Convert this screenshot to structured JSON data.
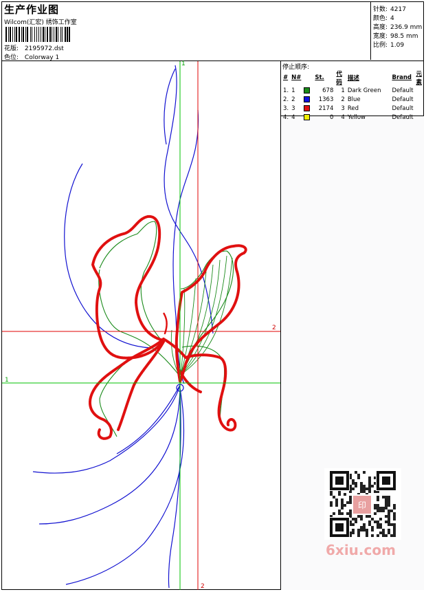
{
  "header": {
    "title": "生产作业图",
    "subtitle": "Wilcom(汇宏) 绣饰工作室",
    "design_label": "花版:",
    "design_value": "2195972.dst",
    "color_label": "色位:",
    "color_value": "Colorway 1"
  },
  "stats": {
    "stitches_label": "针数:",
    "stitches_value": "4217",
    "colors_label": "颜色:",
    "colors_value": "4",
    "height_label": "高度:",
    "height_value": "236.9 mm",
    "width_label": "宽度:",
    "width_value": "98.5 mm",
    "scale_label": "比例:",
    "scale_value": "1.09"
  },
  "stop_sequence": {
    "title": "停止顺序:",
    "headers": [
      "#",
      "N#",
      "St.",
      "代码",
      "描述",
      "Brand",
      "元素"
    ],
    "rows": [
      {
        "num": "1.",
        "n": "1",
        "color": "#1a8a1a",
        "st": "678",
        "code": "1",
        "desc": "Dark Green",
        "brand": "Default"
      },
      {
        "num": "2.",
        "n": "2",
        "color": "#1010e0",
        "st": "1363",
        "code": "2",
        "desc": "Blue",
        "brand": "Default"
      },
      {
        "num": "3.",
        "n": "3",
        "color": "#e01010",
        "st": "2174",
        "code": "3",
        "desc": "Red",
        "brand": "Default"
      },
      {
        "num": "4.",
        "n": "4",
        "color": "#f0f000",
        "st": "0",
        "code": "4",
        "desc": "Yellow",
        "brand": "Default"
      }
    ]
  },
  "axes": {
    "green_top": "1",
    "green_left": "1",
    "red_right": "2",
    "red_bottom": "2"
  },
  "watermark": {
    "text": "6xiu.com",
    "seal": "印"
  }
}
